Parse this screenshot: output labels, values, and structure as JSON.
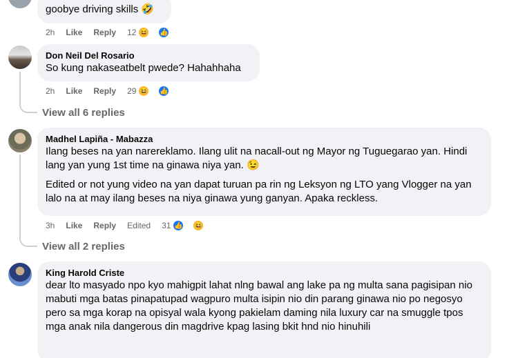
{
  "comments": [
    {
      "author": "",
      "texts": [
        "goobye driving skills 🤣"
      ],
      "time": "2h",
      "like": "Like",
      "reply": "Reply",
      "edited": "",
      "reactions": {
        "count": "12",
        "icons": [
          "haha-icon",
          "like-icon"
        ]
      }
    },
    {
      "author": "Don Neil Del Rosario",
      "texts": [
        "So kung nakaseatbelt pwede? Hahahhaha"
      ],
      "time": "2h",
      "like": "Like",
      "reply": "Reply",
      "edited": "",
      "reactions": {
        "count": "29",
        "icons": [
          "haha-icon",
          "like-icon"
        ]
      },
      "view_replies": "View all 6 replies"
    },
    {
      "author": "Madhel Lapiña - Mabazza",
      "texts": [
        "Ilang beses na yan narereklamo. Ilang ulit na nacall-out ng Mayor ng Tuguegarao yan. Hindi lang yan yung 1st time na ginawa niya yan. 😉",
        "Edited or not yung video na yan dapat turuan pa rin ng Leksyon ng LTO yang Vlogger na yan lalo na at may ilang beses na niya ginawa yung ganyan. Apaka reckless."
      ],
      "time": "3h",
      "like": "Like",
      "reply": "Reply",
      "edited": "Edited",
      "reactions": {
        "count": "31",
        "icons": [
          "like-icon",
          "haha-icon"
        ]
      },
      "view_replies": "View all 2 replies"
    },
    {
      "author": "King Harold Criste",
      "texts": [
        "dear lto masyado npo kyo mahigpit lahat nlng bawal ang lake pa ng multa sana pagisipan nio mabuti mga batas pinapatupad wagpuro multa isipin nio din parang ginawa nio po negosyo pero sa mga korap na opisyal wala kyong pakielam daming nila luxury car na smuggle tpos mga anak nila dangerous din magdrive kpag lasing bkit hnd nio hinuhili"
      ]
    }
  ],
  "colors": {
    "bubble": "#f0f2f5",
    "meta": "#65676b",
    "like_blue": "#1877f2",
    "haha_yellow": "#f7b928"
  }
}
